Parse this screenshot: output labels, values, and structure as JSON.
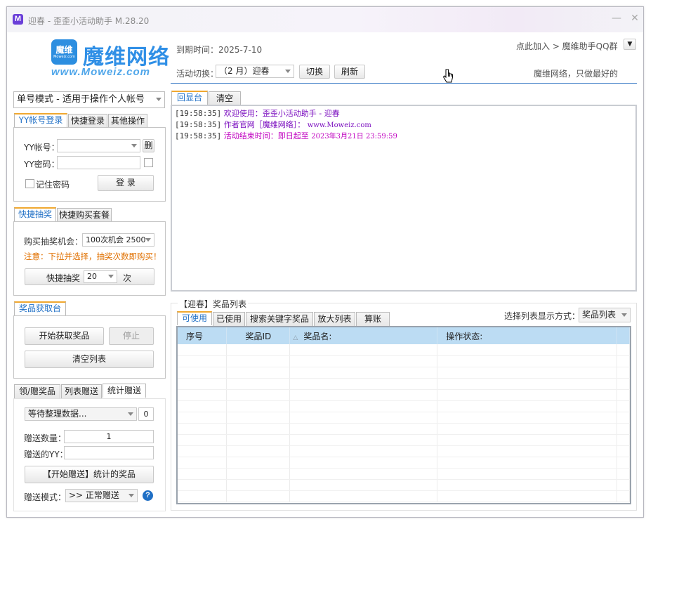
{
  "window": {
    "title": "迎春 - 歪歪小活动助手 M.28.20",
    "icon_letter": "M",
    "minimize_label": "—",
    "close_label": "✕"
  },
  "logo": {
    "box_text": "魔维",
    "box_small": "Moweiz.com",
    "cn": "魔维网络",
    "en": "www.Moweiz.com"
  },
  "header": {
    "expiry": "到期时间：2025-7-10",
    "activity_label": "活动切换：",
    "activity_value": "（2 月）迎春",
    "switch_button": "切换",
    "refresh_button": "刷新",
    "join_link": "点此加入 > 魔维助手QQ群",
    "slogan": "魔维网络，只做最好的"
  },
  "mode_select": "单号模式 - 适用于操作个人帐号",
  "login": {
    "tabs": [
      "YY帐号登录",
      "快捷登录",
      "其他操作"
    ],
    "account_label": "YY帐号：",
    "account_value": "",
    "delete_button": "删",
    "password_label": "YY密码：",
    "password_value": "",
    "remember_label": "记住密码",
    "login_button": "登 录"
  },
  "lottery": {
    "tabs": [
      "快捷抽奖",
      "快捷购买套餐"
    ],
    "buy_label": "购买抽奖机会：",
    "buy_value": "100次机会 2500",
    "note": "注意：下拉并选择，抽奖次数即购买！",
    "draw_button": "快捷抽奖",
    "draw_count": "20",
    "times_label": "次"
  },
  "prize_fetch": {
    "tab": "奖品获取台",
    "start_button": "开始获取奖品",
    "stop_button": "停止",
    "clear_button": "清空列表"
  },
  "gift": {
    "tabs": [
      "领/赠奖品",
      "列表赠送",
      "统计赠送"
    ],
    "status_select": "等待整理数据...",
    "status_count": "0",
    "quantity_label": "赠送数量：",
    "quantity_value": "1",
    "target_label": "赠送的YY：",
    "target_value": "",
    "start_button": "【开始赠送】统计的奖品",
    "mode_label": "赠送模式：",
    "mode_value": ">> 正常赠送",
    "help_icon": "?"
  },
  "console": {
    "tabs": [
      "回显台",
      "清空"
    ],
    "lines": [
      {
        "time": "[19:58:35]",
        "text": "欢迎使用：歪歪小活动助手 - 迎春",
        "extra": ""
      },
      {
        "time": "[19:58:35]",
        "text": "作者官网［魔维网络］：",
        "extra": "www.Moweiz.com"
      },
      {
        "time": "[19:58:35]",
        "text": "活动结束时间：即日起至 ",
        "extra": "2023年3月21日 23:59:59"
      }
    ]
  },
  "prize_list": {
    "title": "【迎春】奖品列表",
    "tabs": [
      "可使用",
      "已使用",
      "搜索关键字奖品",
      "放大列表",
      "算账"
    ],
    "display_label": "选择列表显示方式：",
    "display_value": "奖品列表",
    "columns": [
      "序号",
      "奖品ID",
      "奖品名:",
      "操作状态:"
    ],
    "sort_icon": "△"
  },
  "colors": {
    "accent_blue": "#1f6fc5",
    "log_purple": "#7a0dbf",
    "header_blue": "#bcdcf3",
    "warning_orange": "#e07000"
  }
}
